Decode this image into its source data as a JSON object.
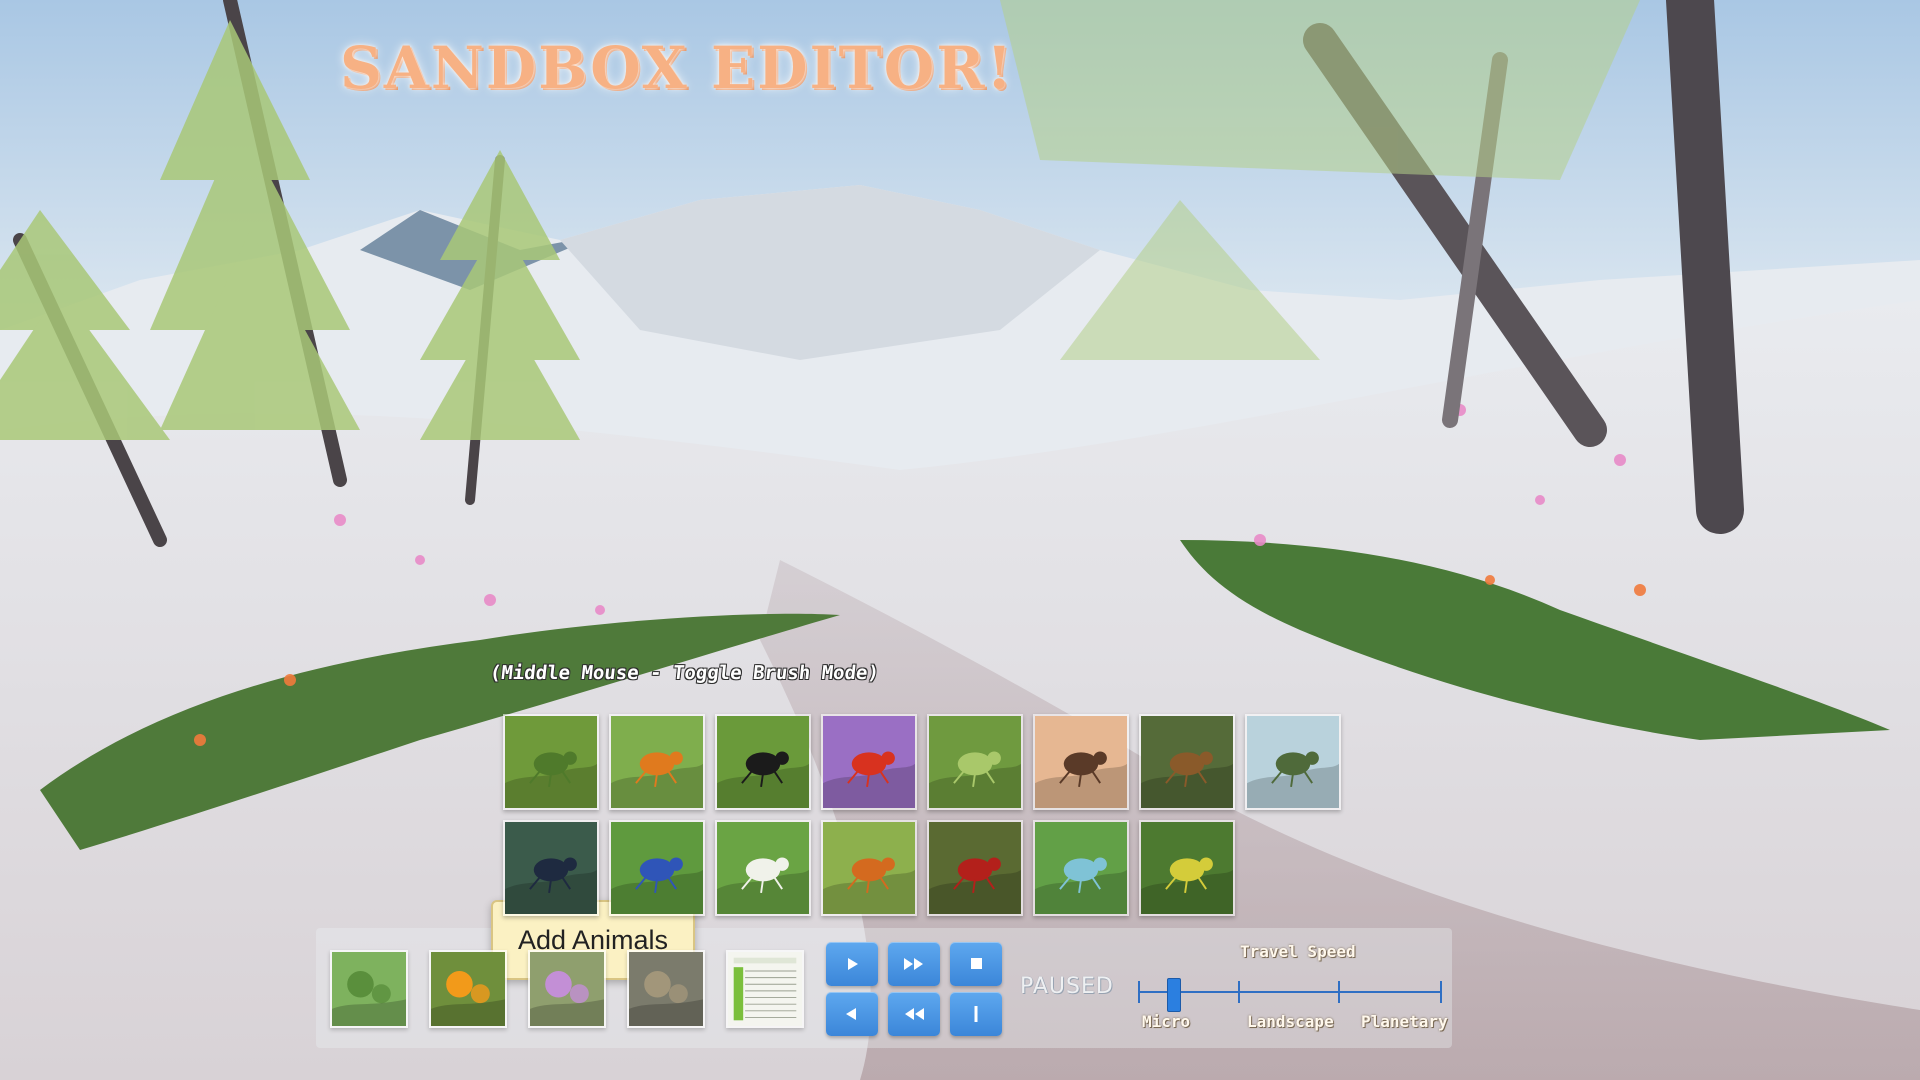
{
  "title": "SANDBOX EDITOR!",
  "hint": "(Middle Mouse - Toggle Brush Mode)",
  "animals_row1": [
    {
      "icon": "praying-mantis-icon",
      "bg": "#6f9a3a",
      "fg": "#4f7a2b"
    },
    {
      "icon": "butterfly-icon",
      "bg": "#7fae4d",
      "fg": "#e07a1e"
    },
    {
      "icon": "beetle-icon",
      "bg": "#6a9a3a",
      "fg": "#1b1b1b"
    },
    {
      "icon": "ladybug-icon",
      "bg": "#9a6fc4",
      "fg": "#d8321f"
    },
    {
      "icon": "grasshopper-icon",
      "bg": "#6f9a3f",
      "fg": "#a9c86a"
    },
    {
      "icon": "ant-silhouette-icon",
      "bg": "#e6b792",
      "fg": "#5a3a28"
    },
    {
      "icon": "bee-icon",
      "bg": "#556b39",
      "fg": "#8a5a2a"
    },
    {
      "icon": "dragonfly-icon",
      "bg": "#b9d2dc",
      "fg": "#4f6a3a"
    }
  ],
  "animals_row2": [
    {
      "icon": "wasp-icon",
      "bg": "#3b5b4b",
      "fg": "#1e2a40"
    },
    {
      "icon": "scorpion-icon",
      "bg": "#5f9a3e",
      "fg": "#2f55b8"
    },
    {
      "icon": "mealybug-icon",
      "bg": "#6aa444",
      "fg": "#f0f2ea"
    },
    {
      "icon": "fire-ant-icon",
      "bg": "#8db04d",
      "fg": "#d46a1f"
    },
    {
      "icon": "red-ant-icon",
      "bg": "#5a6a32",
      "fg": "#b3201b"
    },
    {
      "icon": "blue-beetle-icon",
      "bg": "#62a047",
      "fg": "#7fc3d6"
    },
    {
      "icon": "aphid-icon",
      "bg": "#4d7a30",
      "fg": "#d4cc3a"
    }
  ],
  "worlds": [
    {
      "icon": "grassland-world-icon",
      "bg": "#7eb25e",
      "fg": "#5a8f3c"
    },
    {
      "icon": "flower-world-icon",
      "bg": "#6f8f3c",
      "fg": "#f29a1a"
    },
    {
      "icon": "meadow-world-icon",
      "bg": "#8f9f6e",
      "fg": "#c38fd6"
    },
    {
      "icon": "stump-world-icon",
      "bg": "#7b7b6c",
      "fg": "#a2967a"
    },
    {
      "icon": "spreadsheet-icon",
      "bg": "#f4f5ef",
      "fg": "#7bbf3c"
    }
  ],
  "tooltip": "Add Animals",
  "controls": {
    "play_icon": "play-icon",
    "fast_forward_icon": "fast-forward-icon",
    "stop_icon": "stop-icon",
    "reverse_icon": "reverse-icon",
    "rewind_icon": "rewind-icon",
    "step_icon": "step-icon",
    "status": "PAUSED"
  },
  "travel_speed": {
    "label": "Travel Speed",
    "options": [
      "Micro",
      "Landscape",
      "Planetary"
    ],
    "value_fraction": 0.115,
    "accent": "#2b7fe0"
  }
}
